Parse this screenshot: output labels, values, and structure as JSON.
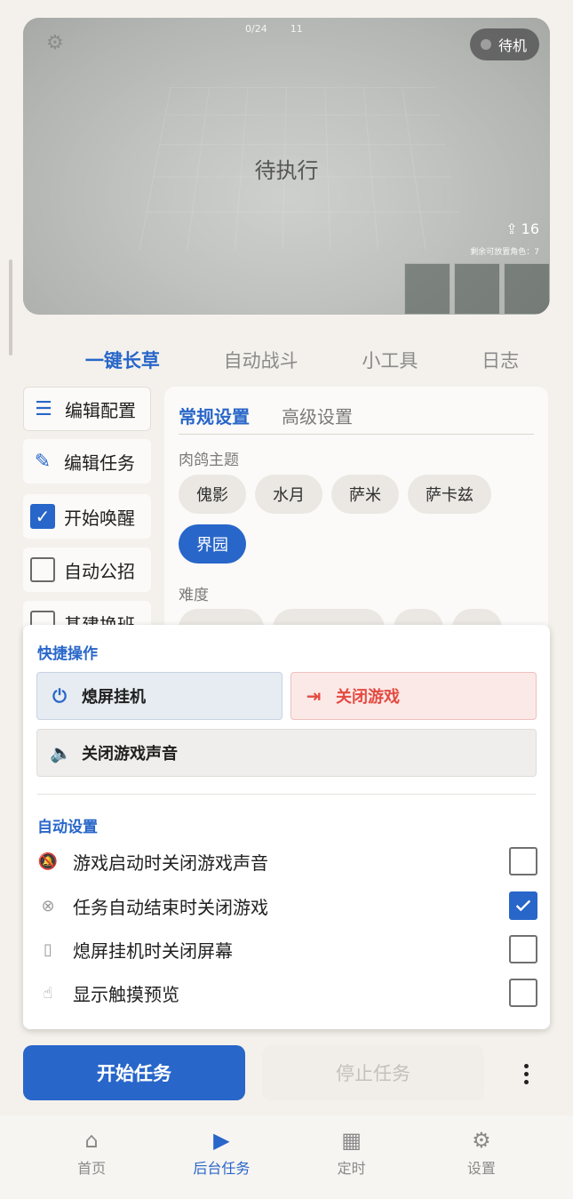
{
  "preview": {
    "hud_counter": "0/24",
    "hud_life": "11",
    "hud_corner": "1",
    "status": "待机",
    "center_text": "待执行",
    "deploy_count": "16",
    "remain_text": "剩余可放置角色：7"
  },
  "main_tabs": [
    {
      "label": "一键长草",
      "active": true
    },
    {
      "label": "自动战斗",
      "active": false
    },
    {
      "label": "小工具",
      "active": false
    },
    {
      "label": "日志",
      "active": false
    }
  ],
  "left_list": {
    "edit_config": "编辑配置",
    "edit_tasks": "编辑任务",
    "tasks": [
      {
        "label": "开始唤醒",
        "checked": true
      },
      {
        "label": "自动公招",
        "checked": false
      },
      {
        "label": "基建换班",
        "checked": false
      }
    ]
  },
  "settings_panel": {
    "tabs": [
      {
        "label": "常规设置",
        "active": true
      },
      {
        "label": "高级设置",
        "active": false
      }
    ],
    "theme_label": "肉鸽主题",
    "themes": [
      {
        "label": "傀影",
        "selected": false
      },
      {
        "label": "水月",
        "selected": false
      },
      {
        "label": "萨米",
        "selected": false
      },
      {
        "label": "萨卡兹",
        "selected": false
      },
      {
        "label": "界园",
        "selected": true
      }
    ],
    "difficulty_label": "难度"
  },
  "quick_ops": {
    "heading": "快捷操作",
    "screen_off_label": "熄屏挂机",
    "close_game_label": "关闭游戏",
    "mute_label": "关闭游戏声音"
  },
  "auto_settings": {
    "heading": "自动设置",
    "items": [
      {
        "label": "游戏启动时关闭游戏声音",
        "checked": false,
        "icon": "bell-off-icon"
      },
      {
        "label": "任务自动结束时关闭游戏",
        "checked": true,
        "icon": "close-circle-icon"
      },
      {
        "label": "熄屏挂机时关闭屏幕",
        "checked": false,
        "icon": "phone-icon"
      },
      {
        "label": "显示触摸预览",
        "checked": false,
        "icon": "touch-icon"
      }
    ]
  },
  "actions": {
    "start": "开始任务",
    "stop": "停止任务"
  },
  "bottom_nav": [
    {
      "label": "首页",
      "icon": "home-icon",
      "active": false
    },
    {
      "label": "后台任务",
      "icon": "play-icon",
      "active": true
    },
    {
      "label": "定时",
      "icon": "calendar-icon",
      "active": false
    },
    {
      "label": "设置",
      "icon": "gear-icon",
      "active": false
    }
  ],
  "colors": {
    "accent": "#2866c9",
    "danger": "#e44a40",
    "background": "#f4f1ec"
  }
}
